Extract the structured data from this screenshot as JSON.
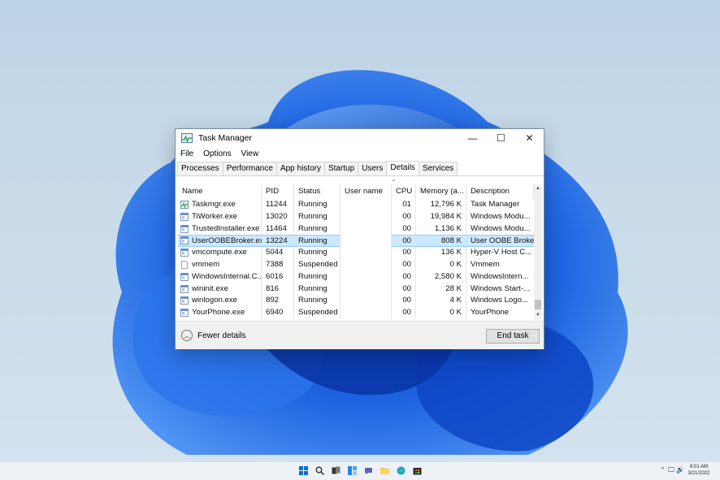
{
  "window": {
    "title": "Task Manager",
    "minimize": "—",
    "maximize": "☐",
    "close": "✕"
  },
  "menu": [
    "File",
    "Options",
    "View"
  ],
  "tabs": [
    {
      "label": "Processes"
    },
    {
      "label": "Performance"
    },
    {
      "label": "App history"
    },
    {
      "label": "Startup"
    },
    {
      "label": "Users"
    },
    {
      "label": "Details",
      "active": true
    },
    {
      "label": "Services"
    }
  ],
  "columns": [
    "Name",
    "PID",
    "Status",
    "User name",
    "CPU",
    "Memory (a...",
    "Description"
  ],
  "rows": [
    {
      "name": "Taskmgr.exe",
      "pid": "11244",
      "status": "Running",
      "user": "",
      "cpu": "01",
      "memory": "12,796 K",
      "description": "Task Manager",
      "icon": "task-manager-icon"
    },
    {
      "name": "TiWorker.exe",
      "pid": "13020",
      "status": "Running",
      "user": "",
      "cpu": "00",
      "memory": "19,984 K",
      "description": "Windows Modu...",
      "icon": "app-icon"
    },
    {
      "name": "TrustedInstaller.exe",
      "pid": "11464",
      "status": "Running",
      "user": "",
      "cpu": "00",
      "memory": "1,136 K",
      "description": "Windows Modu...",
      "icon": "app-icon"
    },
    {
      "name": "UserOOBEBroker.exe",
      "pid": "13224",
      "status": "Running",
      "user": "",
      "cpu": "00",
      "memory": "808 K",
      "description": "User OOBE Broker",
      "icon": "app-icon",
      "selected": true
    },
    {
      "name": "vmcompute.exe",
      "pid": "5044",
      "status": "Running",
      "user": "",
      "cpu": "00",
      "memory": "136 K",
      "description": "Hyper-V Host C...",
      "icon": "app-icon"
    },
    {
      "name": "vmmem",
      "pid": "7388",
      "status": "Suspended",
      "user": "",
      "cpu": "00",
      "memory": "0 K",
      "description": "Vmmem",
      "icon": "blank-file-icon"
    },
    {
      "name": "WindowsInternal.C...",
      "pid": "6016",
      "status": "Running",
      "user": "",
      "cpu": "00",
      "memory": "2,580 K",
      "description": "WindowsIntern...",
      "icon": "app-icon"
    },
    {
      "name": "wininit.exe",
      "pid": "816",
      "status": "Running",
      "user": "",
      "cpu": "00",
      "memory": "28 K",
      "description": "Windows Start-...",
      "icon": "app-icon"
    },
    {
      "name": "winlogon.exe",
      "pid": "892",
      "status": "Running",
      "user": "",
      "cpu": "00",
      "memory": "4 K",
      "description": "Windows Logo...",
      "icon": "app-icon"
    },
    {
      "name": "YourPhone.exe",
      "pid": "6940",
      "status": "Suspended",
      "user": "",
      "cpu": "00",
      "memory": "0 K",
      "description": "YourPhone",
      "icon": "app-icon"
    }
  ],
  "footer": {
    "fewer_details": "Fewer details",
    "end_task": "End task"
  },
  "taskbar": {
    "time": "8:01 AM",
    "date": "3/21/2022",
    "icons": [
      "windows-start-icon",
      "search-icon",
      "task-view-icon",
      "widgets-icon",
      "chat-icon",
      "file-explorer-icon",
      "edge-icon",
      "store-icon"
    ]
  },
  "colors": {
    "selection": "#cce8ff",
    "wallpaper_blue": "#1a5fd6"
  }
}
